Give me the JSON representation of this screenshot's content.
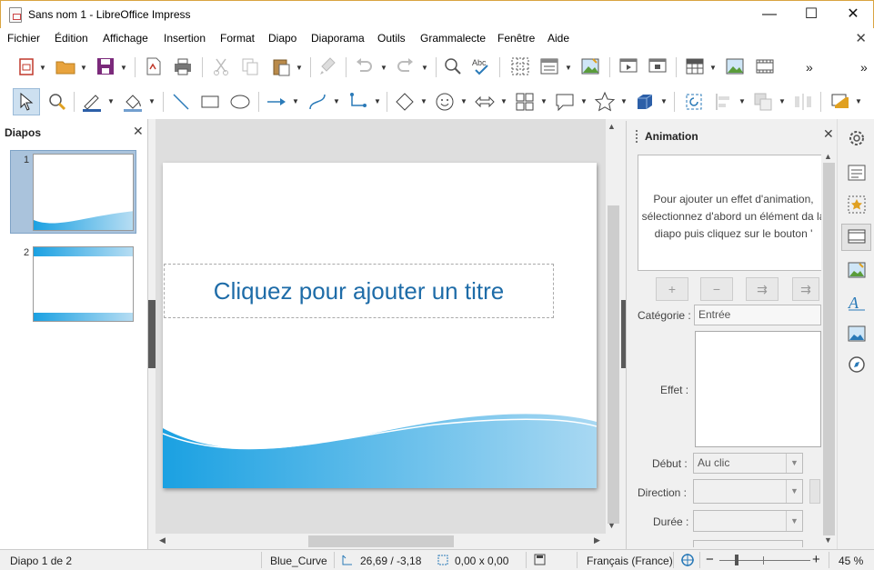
{
  "window": {
    "title": "Sans nom 1 - LibreOffice Impress",
    "minimize": "—",
    "maximize": "☐",
    "close": "✕"
  },
  "menu": {
    "items": [
      "Fichier",
      "Édition",
      "Affichage",
      "Insertion",
      "Format",
      "Diapo",
      "Diaporama",
      "Outils",
      "Grammalecte",
      "Fenêtre",
      "Aide"
    ],
    "close": "✕"
  },
  "toolbar": {
    "overflow": "»"
  },
  "slides_panel": {
    "title": "Diapos",
    "close": "✕",
    "slides": [
      {
        "number": "1"
      },
      {
        "number": "2"
      }
    ]
  },
  "slide": {
    "title_placeholder": "Cliquez pour ajouter un titre"
  },
  "animation_panel": {
    "title": "Animation",
    "close": "✕",
    "empty_message": "Pour ajouter un effet d'animation, sélectionnez d'abord un élément da la diapo puis cliquez sur le bouton '",
    "buttons": {
      "add": "+",
      "remove": "−",
      "move_up": "⇉",
      "move_down": "⇉"
    },
    "category_label": "Catégorie :",
    "category_value": "Entrée",
    "effect_label": "Effet :",
    "start_label": "Début :",
    "start_value": "Au clic",
    "direction_label": "Direction :",
    "direction_value": "",
    "duration_label": "Durée :",
    "duration_value": ""
  },
  "statusbar": {
    "slide_info": "Diapo 1 de 2",
    "master": "Blue_Curve",
    "position": "26,69 / -3,18",
    "size": "0,00 x 0,00",
    "language": "Français (France)",
    "zoom": "45 %",
    "zoom_out": "−",
    "zoom_in": "+"
  },
  "colors": {
    "accent": "#1e6ca8",
    "wave": "#1ba1e2",
    "selection": "#aac3dc"
  }
}
